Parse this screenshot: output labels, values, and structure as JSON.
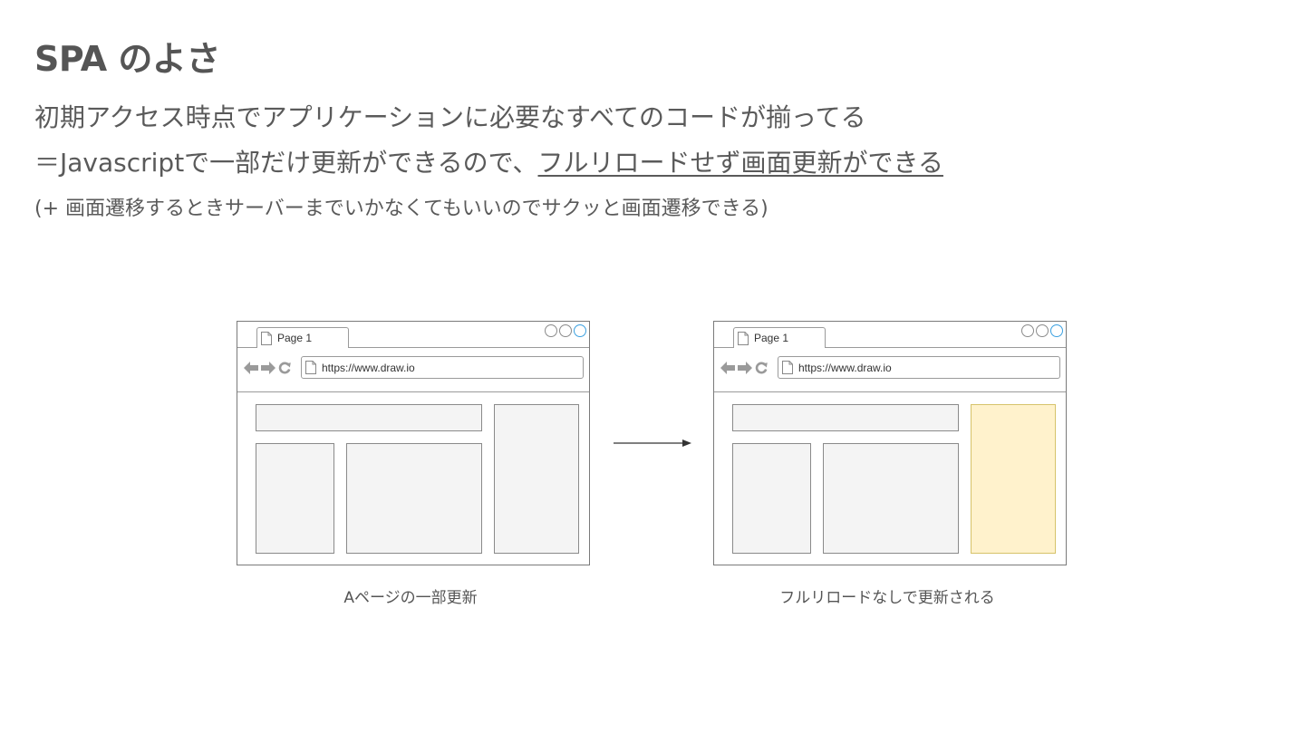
{
  "title": "SPA のよさ",
  "line1": "初期アクセス時点でアプリケーションに必要なすべてのコードが揃ってる",
  "line2": {
    "prefix": "＝Javascriptで一部だけ更新ができるので、",
    "emphasis": "フルリロードせず画面更新ができる"
  },
  "line3": "(+ 画面遷移するときサーバーまでいかなくてもいいのでサクッと画面遷移できる)",
  "browsers": [
    {
      "tab_label": "Page 1",
      "url": "https://www.draw.io",
      "caption": "Aページの一部更新",
      "highlight_color": null
    },
    {
      "tab_label": "Page 1",
      "url": "https://www.draw.io",
      "caption": "フルリロードなしで更新される",
      "highlight_color": "#fff2cc"
    }
  ],
  "icons": [
    "page-icon",
    "back-arrow-icon",
    "forward-arrow-icon",
    "reload-icon",
    "window-control-icon",
    "arrow-right-icon"
  ]
}
